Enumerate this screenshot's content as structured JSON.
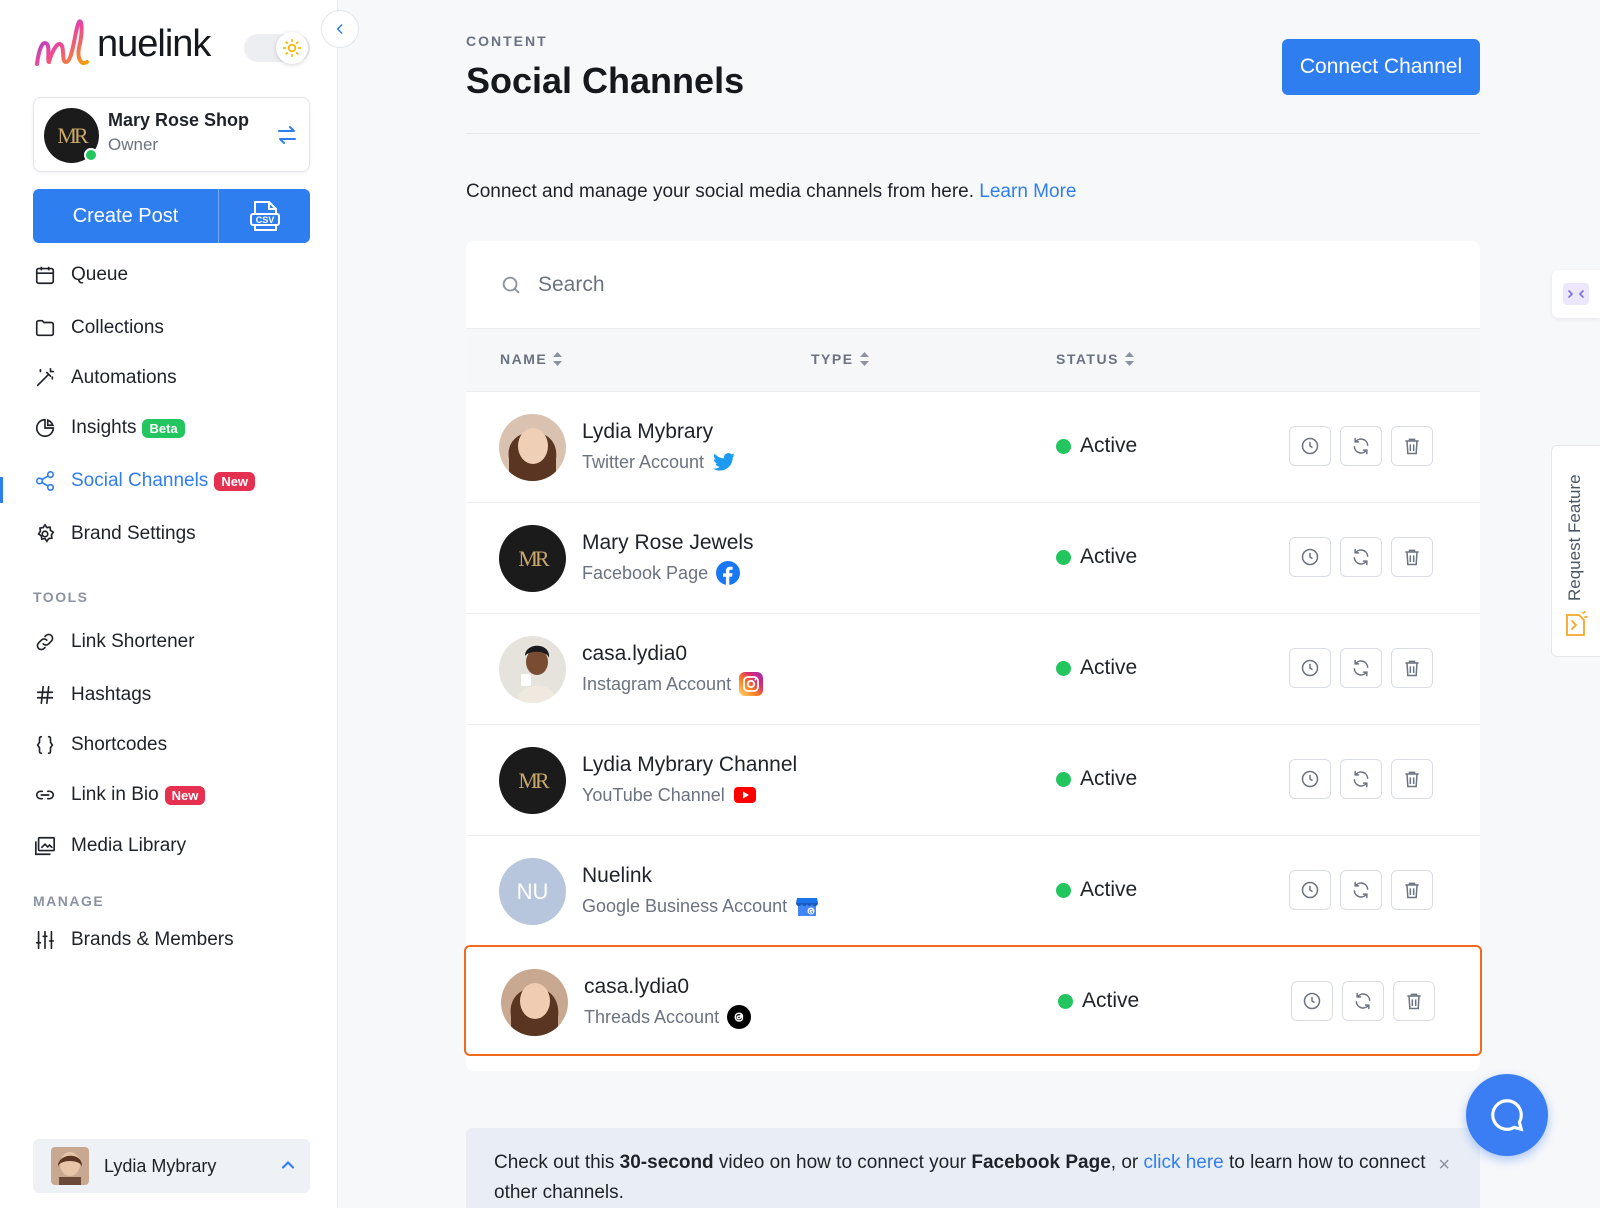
{
  "app": {
    "logo_text": "nuelink"
  },
  "brand": {
    "name": "Mary Rose Shop",
    "role": "Owner",
    "monogram": "MR"
  },
  "create_post": {
    "label": "Create Post",
    "csv_label": "CSV"
  },
  "nav": {
    "queue": "Queue",
    "collections": "Collections",
    "automations": "Automations",
    "insights": "Insights",
    "insights_badge": "Beta",
    "social_channels": "Social Channels",
    "social_channels_badge": "New",
    "brand_settings": "Brand Settings",
    "tools_label": "TOOLS",
    "link_shortener": "Link Shortener",
    "hashtags": "Hashtags",
    "shortcodes": "Shortcodes",
    "link_in_bio": "Link in Bio",
    "link_in_bio_badge": "New",
    "media_library": "Media Library",
    "manage_label": "MANAGE",
    "brands_members": "Brands & Members"
  },
  "user": {
    "name": "Lydia Mybrary"
  },
  "header": {
    "eyebrow": "CONTENT",
    "title": "Social Channels",
    "connect_button": "Connect Channel",
    "intro_text": "Connect and manage your social media channels from here.",
    "learn_more": "Learn More"
  },
  "search": {
    "placeholder": "Search"
  },
  "table": {
    "columns": {
      "name": "NAME",
      "type": "TYPE",
      "status": "STATUS"
    },
    "rows": [
      {
        "name": "Lydia Mybrary",
        "type": "Twitter Account",
        "platform": "twitter-icon",
        "status": "Active",
        "avatar": "photo"
      },
      {
        "name": "Mary Rose Jewels",
        "type": "Facebook Page",
        "platform": "facebook-icon",
        "status": "Active",
        "avatar": "monogram"
      },
      {
        "name": "casa.lydia0",
        "type": "Instagram Account",
        "platform": "instagram-icon",
        "status": "Active",
        "avatar": "photo"
      },
      {
        "name": "Lydia Mybrary Channel",
        "type": "YouTube Channel",
        "platform": "youtube-icon",
        "status": "Active",
        "avatar": "monogram"
      },
      {
        "name": "Nuelink",
        "type": "Google Business Account",
        "platform": "google-business-icon",
        "status": "Active",
        "avatar": "initials",
        "initials": "NU"
      },
      {
        "name": "casa.lydia0",
        "type": "Threads Account",
        "platform": "threads-icon",
        "status": "Active",
        "avatar": "photo",
        "highlighted": true
      }
    ]
  },
  "notice": {
    "part1": "Check out this ",
    "bold1": "30-second",
    "part2": " video on how to connect your ",
    "bold2": "Facebook Page",
    "part3": ", or ",
    "link": "click here",
    "part4": " to learn how to connect other channels.",
    "close": "×"
  },
  "request_feature": {
    "label": "Request Feature"
  },
  "colors": {
    "accent": "#2f7ef0",
    "active": "#22c55e",
    "highlight": "#f26b1d",
    "badge_new": "#e5304f"
  }
}
